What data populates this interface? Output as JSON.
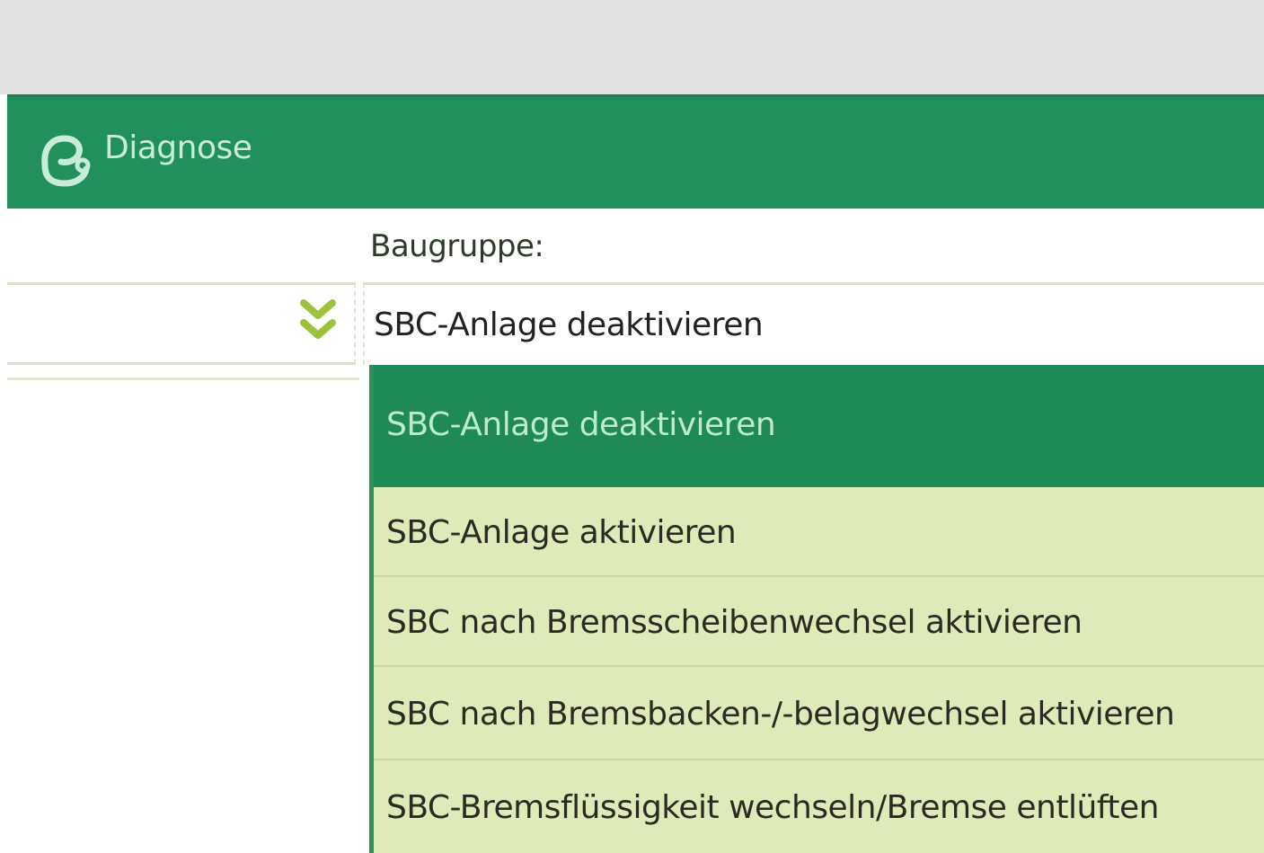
{
  "header": {
    "title": "Diagnose",
    "icon": "diagnose-icon",
    "color": "#22905d"
  },
  "form": {
    "label": "Baugruppe:",
    "selected_value": "SBC-Anlage deaktivieren",
    "expand_icon": "chevron-double-down-icon"
  },
  "dropdown": {
    "options": [
      {
        "label": "SBC-Anlage deaktivieren",
        "selected": true
      },
      {
        "label": "SBC-Anlage aktivieren",
        "selected": false
      },
      {
        "label": "SBC nach Bremsscheibenwechsel aktivieren",
        "selected": false
      },
      {
        "label": "SBC nach Bremsbacken-/-belagwechsel aktivieren",
        "selected": false
      },
      {
        "label": "SBC-Bremsflüssigkeit wechseln/Bremse entlüften",
        "selected": false
      }
    ],
    "highlight_color": "#1f8a57",
    "background_color": "#deeab8"
  }
}
